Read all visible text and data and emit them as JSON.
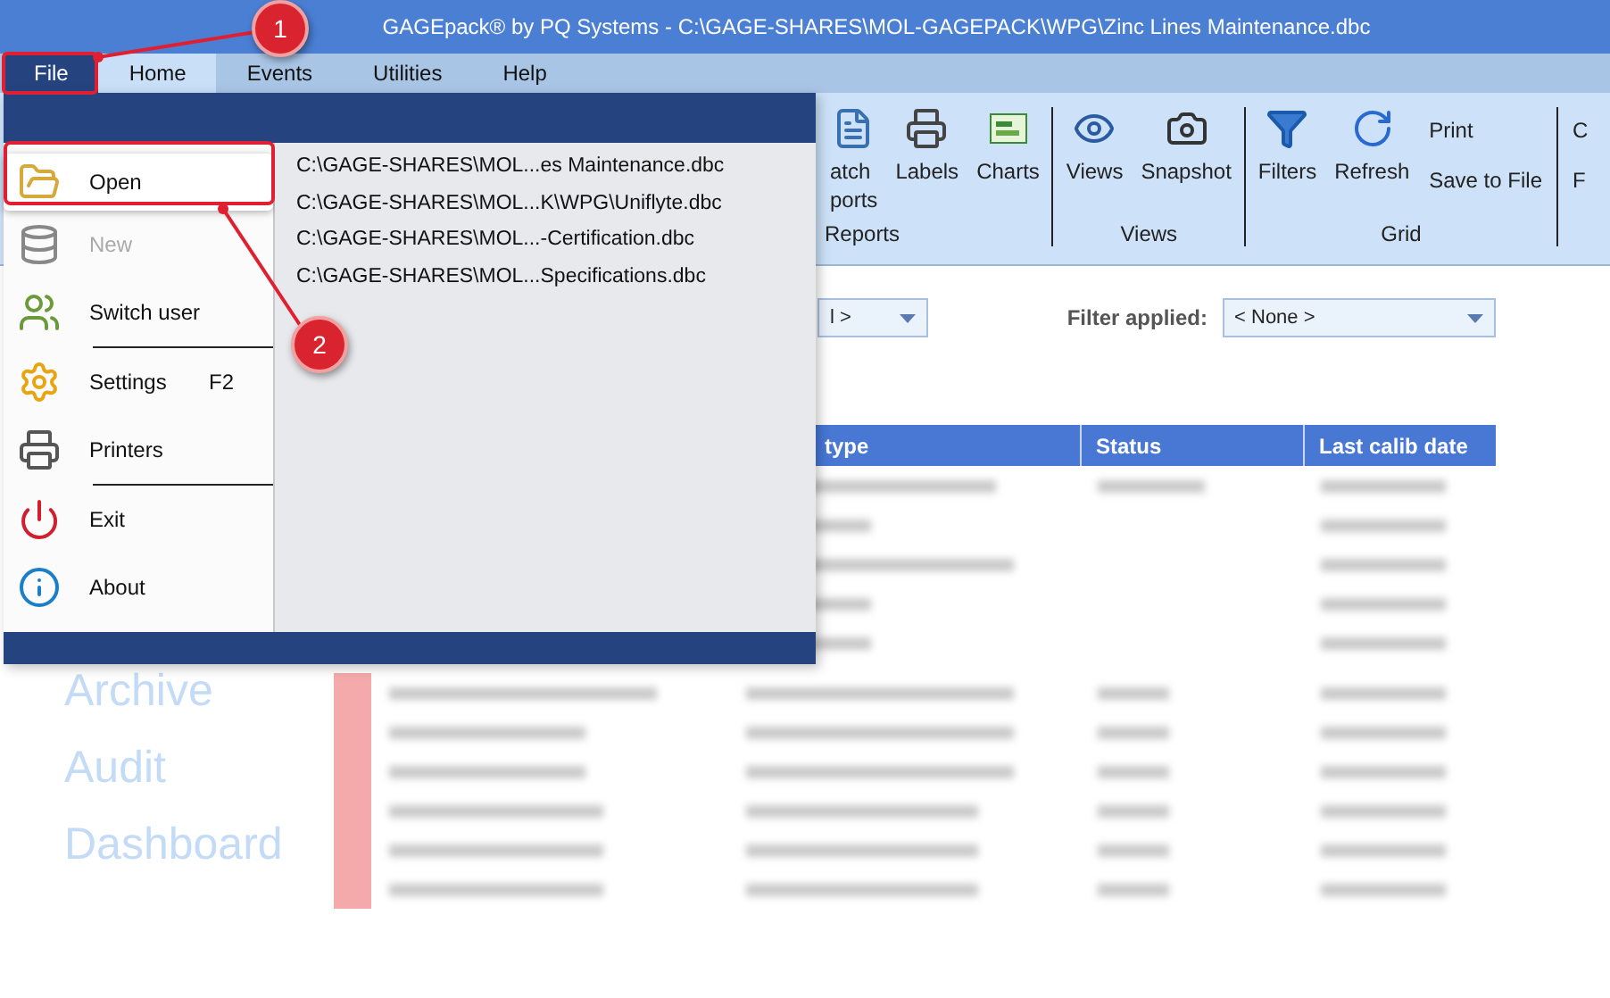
{
  "window": {
    "title": "GAGEpack® by PQ Systems - C:\\GAGE-SHARES\\MOL-GAGEPACK\\WPG\\Zinc Lines Maintenance.dbc"
  },
  "menu_tabs": [
    {
      "label": "File",
      "selected": true
    },
    {
      "label": "Home",
      "selected": false
    },
    {
      "label": "Events",
      "selected": false
    },
    {
      "label": "Utilities",
      "selected": false
    },
    {
      "label": "Help",
      "selected": false
    }
  ],
  "ribbon": {
    "groups": [
      {
        "label": "Reports",
        "buttons": [
          {
            "lines": [
              "atch",
              "ports"
            ]
          },
          {
            "lines": [
              "Labels"
            ]
          },
          {
            "lines": [
              "Charts"
            ]
          }
        ]
      },
      {
        "label": "Views",
        "buttons": [
          {
            "lines": [
              "Views"
            ]
          },
          {
            "lines": [
              "Snapshot"
            ]
          }
        ]
      },
      {
        "label": "Grid",
        "buttons": [
          {
            "lines": [
              "Filters"
            ]
          },
          {
            "lines": [
              "Refresh"
            ]
          }
        ],
        "links": [
          "Print",
          "Save to File"
        ]
      },
      {
        "links": [
          "C",
          "F"
        ]
      }
    ]
  },
  "filters": {
    "view_value": "l >",
    "filter_label": "Filter applied:",
    "filter_value": "< None >"
  },
  "sidebar": {
    "links": [
      "Archive",
      "Audit",
      "Dashboard"
    ]
  },
  "table": {
    "columns": [
      "type",
      "Status",
      "Last calib date"
    ],
    "rows": [
      {
        "kind": "covered"
      },
      {
        "kind": "covered"
      },
      {
        "kind": "covered"
      },
      {
        "kind": "covered"
      },
      {
        "kind": "covered"
      },
      {
        "kind": "full",
        "color": "#f4aaaa"
      },
      {
        "kind": "full",
        "color": "#f4aaaa"
      },
      {
        "kind": "full",
        "color": "#f4aaaa"
      },
      {
        "kind": "full",
        "color": "#f4aaaa"
      },
      {
        "kind": "full",
        "color": "#f4aaaa"
      },
      {
        "kind": "full",
        "color": "#f4aaaa"
      }
    ]
  },
  "file_menu": {
    "items": [
      {
        "label": "Open",
        "selected": true,
        "disabled": false,
        "separator_after": false
      },
      {
        "label": "New",
        "selected": false,
        "disabled": true,
        "separator_after": false
      },
      {
        "label": "Switch user",
        "selected": false,
        "disabled": false,
        "separator_after": true
      },
      {
        "label": "Settings",
        "shortcut": "F2",
        "selected": false,
        "disabled": false,
        "separator_after": false
      },
      {
        "label": "Printers",
        "selected": false,
        "disabled": false,
        "separator_after": true
      },
      {
        "label": "Exit",
        "selected": false,
        "disabled": false,
        "separator_after": false
      },
      {
        "label": "About",
        "selected": false,
        "disabled": false,
        "separator_after": false
      }
    ],
    "recent_files": [
      "C:\\GAGE-SHARES\\MOL...es Maintenance.dbc",
      "C:\\GAGE-SHARES\\MOL...K\\WPG\\Uniflyte.dbc",
      "C:\\GAGE-SHARES\\MOL...-Certification.dbc",
      "C:\\GAGE-SHARES\\MOL...Specifications.dbc"
    ]
  },
  "callouts": [
    "1",
    "2"
  ]
}
